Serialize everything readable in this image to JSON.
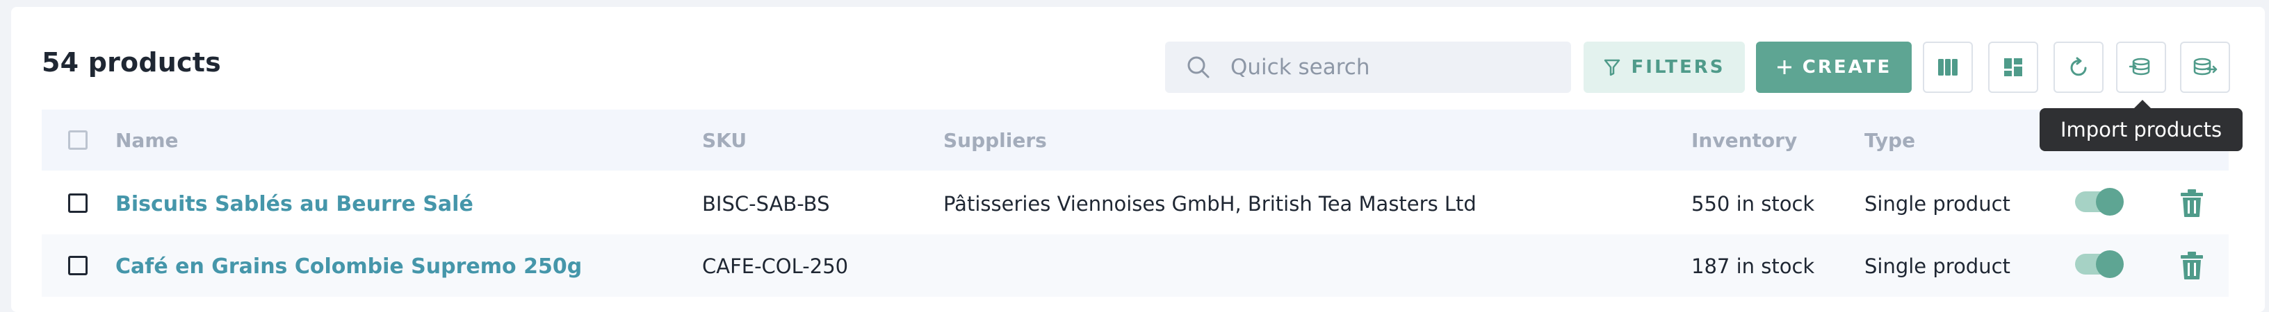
{
  "header": {
    "title": "54 products"
  },
  "toolbar": {
    "search_placeholder": "Quick search",
    "filters_label": "FILTERS",
    "create_label": "CREATE",
    "icons": [
      "columns-icon",
      "layout-icon",
      "refresh-icon",
      "import-icon",
      "export-icon"
    ],
    "tooltip": "Import products"
  },
  "table": {
    "columns": [
      "Name",
      "SKU",
      "Suppliers",
      "Inventory",
      "Type"
    ],
    "rows": [
      {
        "name": "Biscuits Sablés au Beurre Salé",
        "sku": "BISC-SAB-BS",
        "suppliers": "Pâtisseries Viennoises GmbH, British Tea Masters Ltd",
        "inventory": "550 in stock",
        "type": "Single product",
        "active": true
      },
      {
        "name": "Café en Grains Colombie Supremo 250g",
        "sku": "CAFE-COL-250",
        "suppliers": "",
        "inventory": "187 in stock",
        "type": "Single product",
        "active": true
      }
    ]
  },
  "colors": {
    "accent": "#5ea593",
    "accent_light": "#e3f2ee",
    "link": "#4596aa",
    "header_bg": "#f3f6fc"
  }
}
